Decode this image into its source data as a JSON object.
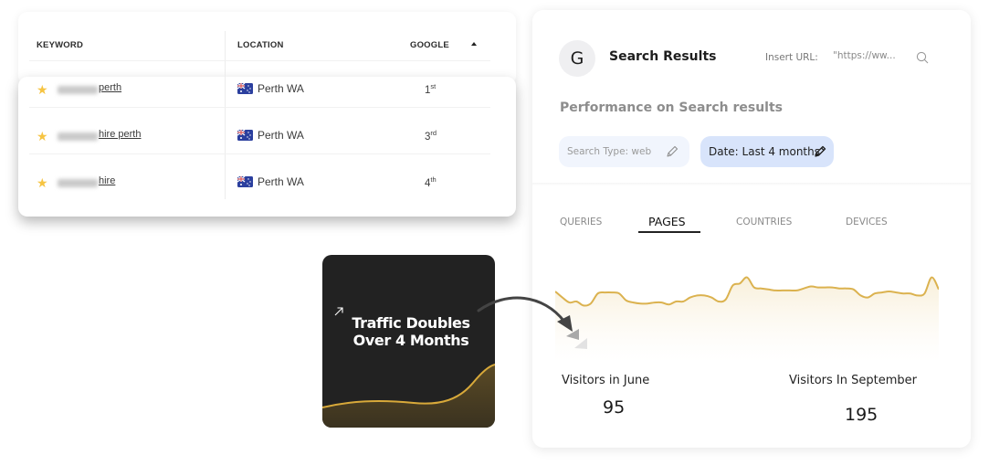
{
  "keyword_table": {
    "headers": {
      "keyword": "KEYWORD",
      "location": "LOCATION",
      "google": "GOOGLE"
    },
    "sort_icon": "caret-up-icon",
    "rows": [
      {
        "keyword_visible": "perth",
        "keyword_blurred": true,
        "starred": true,
        "flag": "australia-flag",
        "location": "Perth WA",
        "rank": "1",
        "rank_suffix": "st"
      },
      {
        "keyword_visible": "hire perth",
        "keyword_blurred": true,
        "starred": true,
        "flag": "australia-flag",
        "location": "Perth WA",
        "rank": "3",
        "rank_suffix": "rd"
      },
      {
        "keyword_visible": "hire",
        "keyword_blurred": true,
        "starred": true,
        "flag": "australia-flag",
        "location": "Perth WA",
        "rank": "4",
        "rank_suffix": "th"
      }
    ]
  },
  "callout": {
    "icon": "arrow-up-right-icon",
    "line1": "Traffic Doubles",
    "line2": "Over 4 Months"
  },
  "panel": {
    "avatar_letter": "G",
    "title": "Search Results",
    "url_label": "Insert URL:",
    "url_placeholder": "\"https://ww...",
    "search_icon": "search-icon",
    "subtitle": "Performance on Search results",
    "filters": [
      {
        "label": "Search Type: web",
        "icon": "pencil-icon"
      },
      {
        "label": "Date: Last 4 months",
        "icon": "pencil-icon",
        "active": true
      }
    ],
    "tabs": [
      {
        "label": "QUERIES"
      },
      {
        "label": "PAGES",
        "active": true
      },
      {
        "label": "COUNTRIES"
      },
      {
        "label": "DEVICES"
      }
    ],
    "stats": [
      {
        "label": "Visitors in June",
        "value": "95"
      },
      {
        "label": "Visitors In September",
        "value": "195"
      }
    ],
    "colors": {
      "line": "#dbb24f",
      "fill": "#fbf3e1",
      "active_chip": "#d8e4fb",
      "chip": "#f1f5fd"
    }
  },
  "chart_data": {
    "type": "area",
    "title": "",
    "xlabel": "",
    "ylabel": "",
    "grid": false,
    "legend": "none",
    "ylim": [
      0,
      100
    ],
    "values": [
      70,
      64,
      59,
      60,
      56,
      58,
      68,
      69,
      69,
      68,
      61,
      59,
      58,
      58,
      59,
      59,
      57,
      60,
      60,
      64,
      66,
      66,
      64,
      60,
      62,
      76,
      78,
      84,
      74,
      73,
      72,
      71,
      71,
      71,
      71,
      73,
      75,
      74,
      74,
      74,
      73,
      73,
      72,
      66,
      64,
      68,
      69,
      70,
      69,
      68,
      68,
      66,
      68,
      84,
      72
    ]
  }
}
